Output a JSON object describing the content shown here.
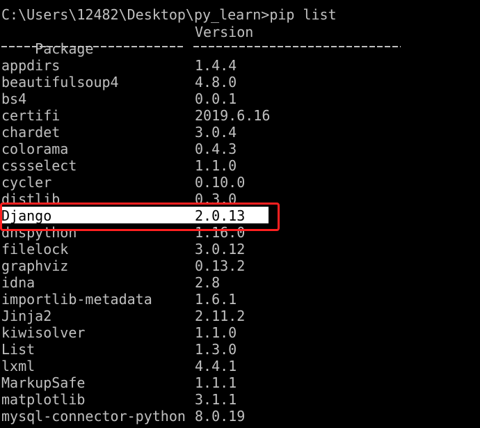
{
  "terminal": {
    "prompt_line": "C:\\Users\\12482\\Desktop\\py_learn>pip list",
    "header": {
      "package": "Package",
      "version": "Version"
    },
    "packages": [
      {
        "name": "appdirs",
        "version": "1.4.4"
      },
      {
        "name": "beautifulsoup4",
        "version": "4.8.0"
      },
      {
        "name": "bs4",
        "version": "0.0.1"
      },
      {
        "name": "certifi",
        "version": "2019.6.16"
      },
      {
        "name": "chardet",
        "version": "3.0.4"
      },
      {
        "name": "colorama",
        "version": "0.4.3"
      },
      {
        "name": "cssselect",
        "version": "1.1.0"
      },
      {
        "name": "cycler",
        "version": "0.10.0"
      },
      {
        "name": "distlib",
        "version": "0.3.0"
      },
      {
        "name": "Django",
        "version": "2.0.13"
      },
      {
        "name": "dnspython",
        "version": "1.16.0"
      },
      {
        "name": "filelock",
        "version": "3.0.12"
      },
      {
        "name": "graphviz",
        "version": "0.13.2"
      },
      {
        "name": "idna",
        "version": "2.8"
      },
      {
        "name": "importlib-metadata",
        "version": "1.6.1"
      },
      {
        "name": "Jinja2",
        "version": "2.11.2"
      },
      {
        "name": "kiwisolver",
        "version": "1.1.0"
      },
      {
        "name": "List",
        "version": "1.3.0"
      },
      {
        "name": "lxml",
        "version": "4.4.1"
      },
      {
        "name": "MarkupSafe",
        "version": "1.1.1"
      },
      {
        "name": "matplotlib",
        "version": "3.1.1"
      },
      {
        "name": "mysql-connector-python",
        "version": "8.0.19"
      }
    ],
    "selected_package": "Django",
    "colors": {
      "background": "#000000",
      "text": "#c0c0c0",
      "selection_bg": "#ffffff",
      "selection_text": "#000000",
      "annotation_box": "#ff2020"
    }
  }
}
